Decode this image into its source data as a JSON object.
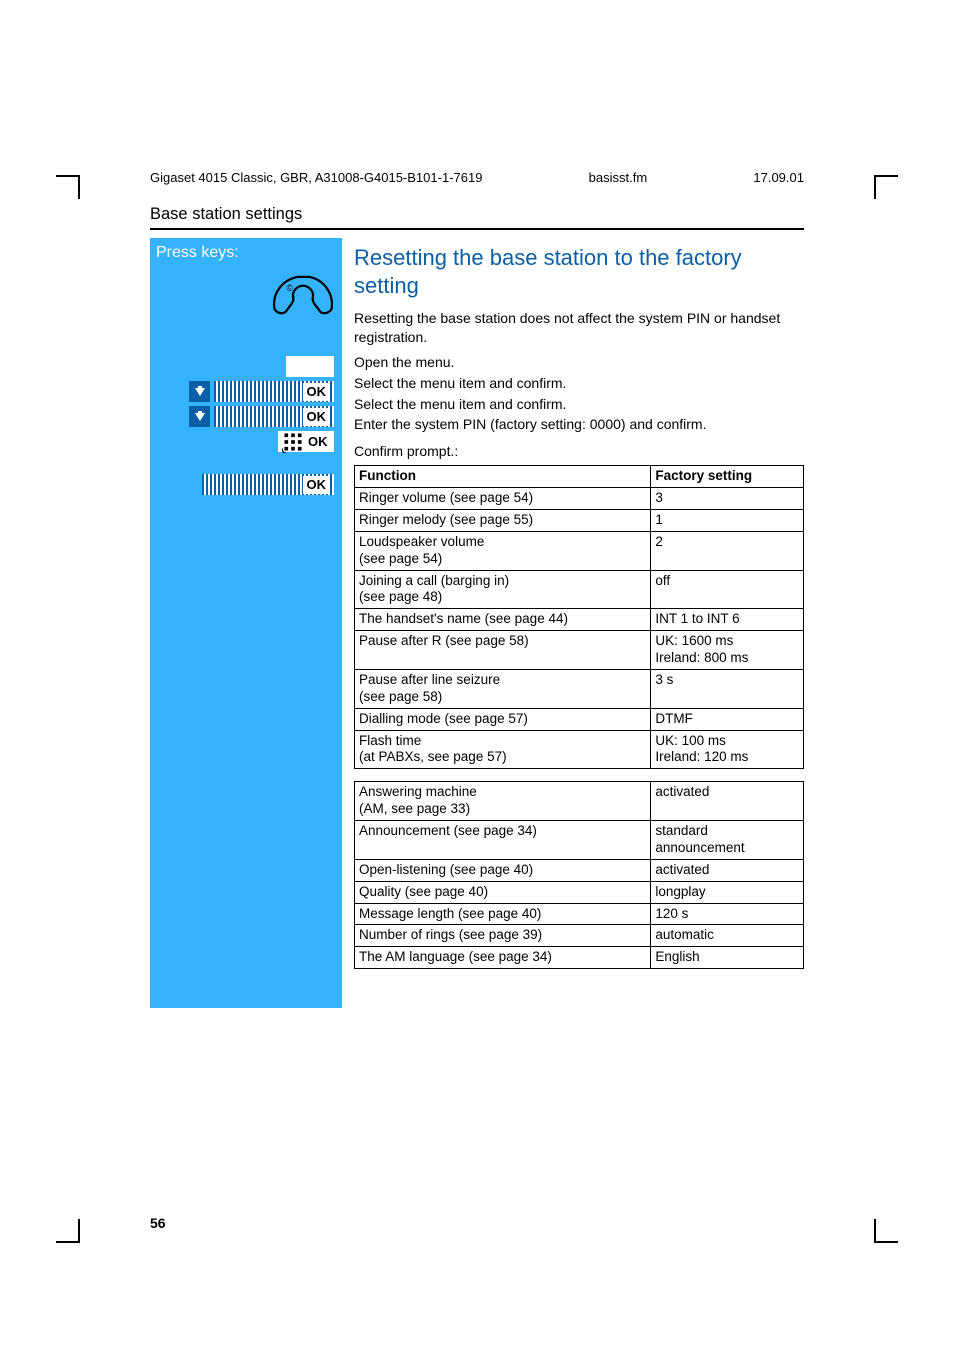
{
  "header": {
    "doc": "Gigaset 4015 Classic, GBR, A31008-G4015-B101-1-7619",
    "file": "basisst.fm",
    "date": "17.09.01"
  },
  "section_title": "Base station settings",
  "left": {
    "press_keys": "Press keys:",
    "ok": "OK"
  },
  "heading": "Resetting the base station to the factory setting",
  "intro": "Resetting the base station does not affect the system PIN or handset registration.",
  "steps": {
    "open_menu": "Open the menu.",
    "select1": "Select the menu item and confirm.",
    "select2": "Select the menu item and confirm.",
    "pin": "Enter the system PIN (factory setting: 0000) and confirm.",
    "confirm": "Confirm prompt.:"
  },
  "table1": {
    "headers": [
      "Function",
      "Factory setting"
    ],
    "rows": [
      [
        "Ringer volume (see page 54)",
        "3"
      ],
      [
        "Ringer melody (see page 55)",
        "1"
      ],
      [
        "Loudspeaker volume\n(see page 54)",
        "2"
      ],
      [
        "Joining a call (barging in)\n(see page 48)",
        "off"
      ],
      [
        "The handset's name (see page 44)",
        "INT 1 to INT 6"
      ],
      [
        "Pause after R (see page 58)",
        "UK: 1600 ms\nIreland: 800 ms"
      ],
      [
        "Pause after line seizure\n(see page 58)",
        "3 s"
      ],
      [
        "Dialling mode (see page 57)",
        "DTMF"
      ],
      [
        "Flash time\n(at PABXs, see page 57)",
        "UK: 100 ms\nIreland: 120 ms"
      ]
    ]
  },
  "table2": {
    "rows": [
      [
        "Answering machine\n(AM, see page 33)",
        "activated"
      ],
      [
        "Announcement (see page 34)",
        "standard\nannouncement"
      ],
      [
        "Open-listening (see page 40)",
        "activated"
      ],
      [
        "Quality (see page 40)",
        "longplay"
      ],
      [
        "Message length (see page 40)",
        "120 s"
      ],
      [
        "Number of rings (see page 39)",
        "automatic"
      ],
      [
        "The AM language (see page 34)",
        "English"
      ]
    ]
  },
  "page_number": "56"
}
